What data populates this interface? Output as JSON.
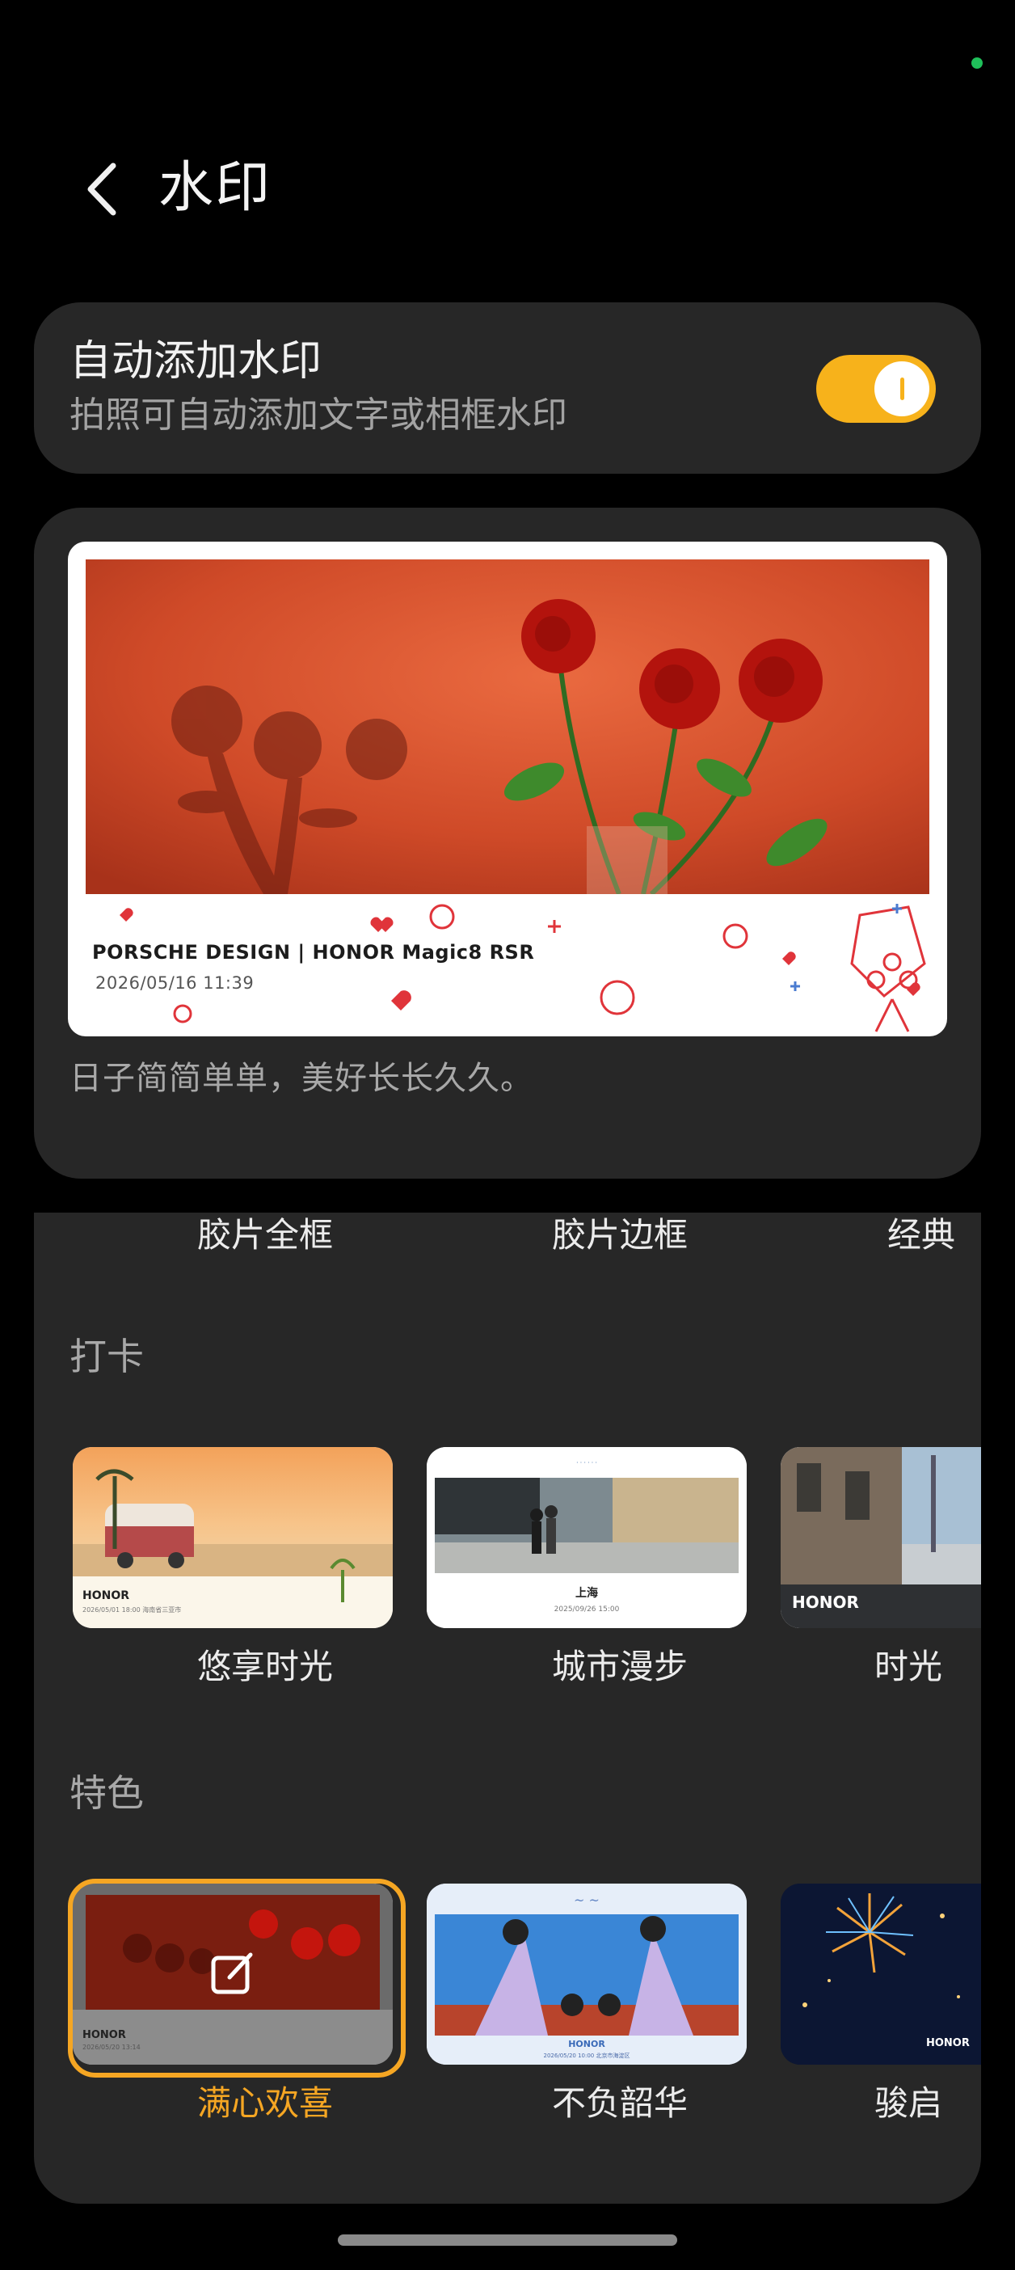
{
  "header": {
    "title": "水印",
    "back_icon": "chevron-left-icon"
  },
  "auto_watermark": {
    "title": "自动添加水印",
    "subtitle": "拍照可自动添加文字或相框水印",
    "toggle_on": true,
    "toggle_color": "#f7b21b"
  },
  "preview": {
    "brand_line": "PORSCHE DESIGN | HONOR Magic8 RSR",
    "datetime": "2026/05/16 11:39",
    "caption": "日子简简单单，美好长长久久。"
  },
  "frame_row": {
    "items": [
      "胶片全框",
      "胶片边框",
      "经典"
    ]
  },
  "sections": [
    {
      "title": "打卡",
      "items": [
        {
          "label": "悠享时光",
          "thumb_brand": "HONOR",
          "thumb_text": "2026/05/01 18:00 海南省三亚市"
        },
        {
          "label": "城市漫步",
          "thumb_brand": "上海",
          "thumb_text": "2025/09/26 15:00"
        },
        {
          "label": "时光",
          "thumb_brand": "HONOR",
          "thumb_text": ""
        }
      ]
    },
    {
      "title": "特色",
      "items": [
        {
          "label": "满心欢喜",
          "selected": true,
          "thumb_brand": "HONOR",
          "thumb_text": "2026/05/20 13:14"
        },
        {
          "label": "不负韶华",
          "thumb_brand": "HONOR",
          "thumb_text": "2026/05/20 10:00 北京市海淀区"
        },
        {
          "label": "骏启",
          "thumb_brand": "HONOR",
          "thumb_text": ""
        }
      ]
    }
  ],
  "colors": {
    "accent": "#f5a623",
    "card": "#272727",
    "background": "#000000"
  }
}
